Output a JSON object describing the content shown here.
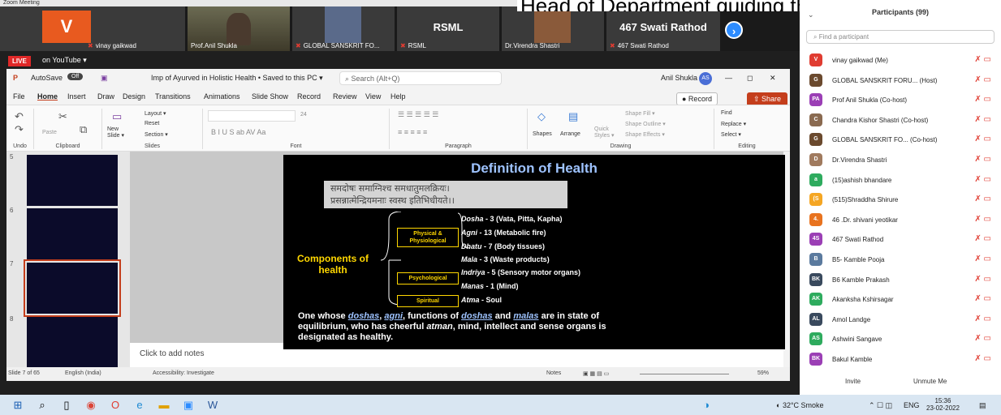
{
  "window": {
    "title": "Zoom Meeting"
  },
  "caption_overlay": "Head of Department guiding the s",
  "video_tiles": [
    {
      "name": "vinay gaikwad",
      "avatar_letter": "V",
      "avatar_color": "#e85a1f"
    },
    {
      "name": "Prof.Anil Shukla"
    },
    {
      "name": "GLOBAL SANSKRIT FO..."
    },
    {
      "name": "RSML",
      "big_label": "RSML"
    },
    {
      "name": "Dr.Virendra Shastri"
    },
    {
      "name": "467 Swati Rathod",
      "big_label": "467 Swati Rathod"
    }
  ],
  "live": {
    "badge": "LIVE",
    "label": "on YouTube ▾"
  },
  "ppt": {
    "autosave_label": "AutoSave",
    "autosave_state": "Off",
    "doc_title": "Imp of Ayurved in Holistic Health • Saved to this PC ▾",
    "search_placeholder": "Search (Alt+Q)",
    "user": "Anil Shukla",
    "user_initials": "AS",
    "menu": [
      "File",
      "Home",
      "Insert",
      "Draw",
      "Design",
      "Transitions",
      "Animations",
      "Slide Show",
      "Record",
      "Review",
      "View",
      "Help"
    ],
    "record_label": "● Record",
    "share_label": "⇧ Share",
    "groups": {
      "undo": "Undo",
      "clipboard": "Clipboard",
      "slides": "Slides",
      "font": "Font",
      "paragraph": "Paragraph",
      "drawing": "Drawing",
      "editing": "Editing"
    },
    "ribbon": {
      "paste": "Paste",
      "new_slide": "New Slide ▾",
      "layout": "Layout ▾",
      "reset": "Reset",
      "section": "Section ▾",
      "font_size": "24",
      "shapes": "Shapes",
      "arrange": "Arrange",
      "quick_styles": "Quick Styles ▾",
      "shape_fill": "Shape Fill ▾",
      "shape_outline": "Shape Outline ▾",
      "shape_effects": "Shape Effects ▾",
      "find": "Find",
      "replace": "Replace ▾",
      "select": "Select ▾"
    },
    "thumbnails": [
      {
        "num": "5"
      },
      {
        "num": "6"
      },
      {
        "num": "7"
      },
      {
        "num": "8"
      }
    ],
    "notes_placeholder": "Click to add notes",
    "status": {
      "slide": "Slide 7 of 65",
      "language": "English (India)",
      "accessibility": "Accessibility: Investigate",
      "notes": "Notes",
      "zoom": "59%"
    }
  },
  "slide": {
    "title": "Definition of Health",
    "sanskrit_line1": "समदोषः समाग्निश्च समधातुमलक्रियः।",
    "sanskrit_line2": "प्रसन्नात्मेन्द्रियमनाः स्वस्थ इतिभिधीयते।।",
    "components": "Components of health",
    "cat_physical": "Physical & Physiological",
    "cat_psych": "Psychological",
    "cat_spiritual": "Spiritual",
    "items": [
      {
        "term": "Dosha",
        "desc": " - 3 (Vata, Pitta, Kapha)"
      },
      {
        "term": "Agni",
        "desc": "  - 13 (Metabolic fire)"
      },
      {
        "term": "Dhatu",
        "desc": " - 7 (Body tissues)"
      },
      {
        "term": "Mala",
        "desc": "  - 3 (Waste products)"
      },
      {
        "term": "Indriya",
        "desc": " - 5 (Sensory motor organs)"
      },
      {
        "term": "Manas",
        "desc": " - 1 (Mind)"
      },
      {
        "term": "Atma",
        "desc": "  - Soul"
      }
    ],
    "bottom_1": "One whose ",
    "bottom_doshas": "doshas",
    "bottom_2": ", ",
    "bottom_agni": "agni",
    "bottom_3": ", functions of ",
    "bottom_doshas2": "doshas",
    "bottom_4": " and ",
    "bottom_malas": "malas",
    "bottom_5": " are in state of equilibrium, who has cheerful ",
    "bottom_atman": "atman",
    "bottom_6": ", mind, intellect and sense organs is designated as healthy."
  },
  "participants": {
    "title": "Participants (99)",
    "find_placeholder": "Find a participant",
    "list": [
      {
        "initials": "V",
        "color": "#e03c31",
        "name": "vinay gaikwad (Me)"
      },
      {
        "initials": "G",
        "color": "#6b4a2e",
        "name": "GLOBAL SANSKRIT FORU... (Host)"
      },
      {
        "initials": "PA",
        "color": "#9b3fb5",
        "name": "Prof Anil Shukla (Co-host)"
      },
      {
        "initials": "C",
        "color": "#8a6a50",
        "name": "Chandra Kishor Shastri (Co-host)"
      },
      {
        "initials": "G",
        "color": "#6b4a2e",
        "name": "GLOBAL SANSKRIT FO... (Co-host)"
      },
      {
        "initials": "D",
        "color": "#a07a5e",
        "name": "Dr.Virendra Shastri"
      },
      {
        "initials": "a",
        "color": "#2eab5e",
        "name": "(15)ashish bhandare"
      },
      {
        "initials": "(S",
        "color": "#f5a623",
        "name": "(515)Shraddha Shirure"
      },
      {
        "initials": "4.",
        "color": "#e8731f",
        "name": "46 .Dr. shivani yeotikar"
      },
      {
        "initials": "4S",
        "color": "#9b3fb5",
        "name": "467 Swati Rathod"
      },
      {
        "initials": "B",
        "color": "#5b7a9e",
        "name": "B5- Kamble Pooja"
      },
      {
        "initials": "BK",
        "color": "#3a4a5e",
        "name": "B6 Kamble Prakash"
      },
      {
        "initials": "AK",
        "color": "#2eab5e",
        "name": "Akanksha Kshirsagar"
      },
      {
        "initials": "AL",
        "color": "#3a4a5e",
        "name": "Amol Landge"
      },
      {
        "initials": "AS",
        "color": "#2eab5e",
        "name": "Ashwini Sangave"
      },
      {
        "initials": "BK",
        "color": "#9b3fb5",
        "name": "Bakul Kamble"
      }
    ],
    "invite": "Invite",
    "unmute": "Unmute Me"
  },
  "taskbar": {
    "weather": "32°C Smoke",
    "lang": "ENG",
    "time": "15:36",
    "date": "23-02-2022"
  }
}
